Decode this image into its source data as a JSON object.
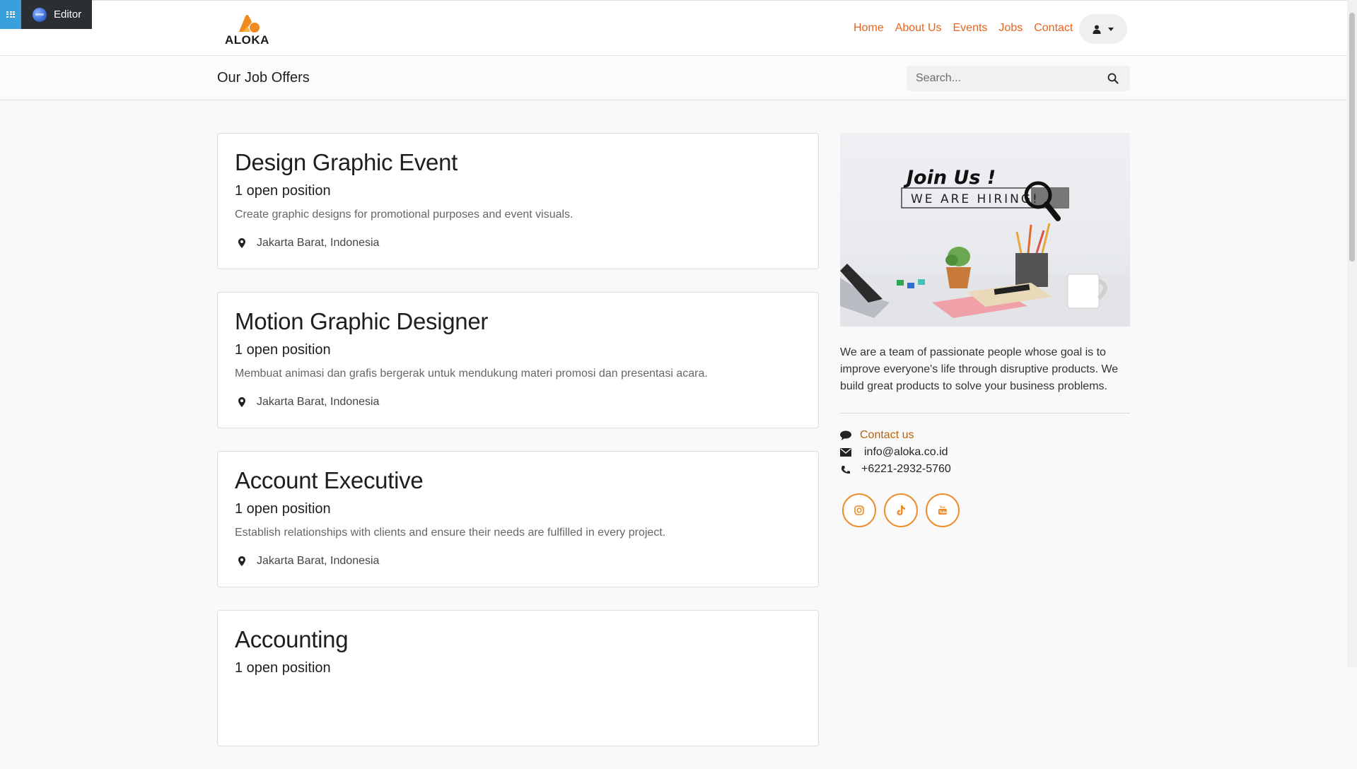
{
  "editor": {
    "label": "Editor",
    "globe_text": "www"
  },
  "header": {
    "logo_text": "ALOKA",
    "nav": [
      "Home",
      "About Us",
      "Events",
      "Jobs",
      "Contact"
    ],
    "accent_color": "#e8641c"
  },
  "subheader": {
    "title": "Our Job Offers",
    "search_placeholder": "Search..."
  },
  "jobs": [
    {
      "title": "Design Graphic Event",
      "positions": "1 open position",
      "description": "Create graphic designs for promotional purposes and event visuals.",
      "location": "Jakarta Barat, Indonesia"
    },
    {
      "title": "Motion Graphic Designer",
      "positions": "1 open position",
      "description": "Membuat animasi dan grafis bergerak untuk mendukung materi promosi dan presentasi acara.",
      "location": "Jakarta Barat, Indonesia"
    },
    {
      "title": "Account Executive",
      "positions": "1 open position",
      "description": "Establish relationships with clients and ensure their needs are fulfilled in every project.",
      "location": "Jakarta Barat, Indonesia"
    },
    {
      "title": "Accounting",
      "positions": "1 open position",
      "description": "",
      "location": ""
    }
  ],
  "sidebar": {
    "image_text": {
      "headline": "Join Us !",
      "subline": "WE ARE HIRING!"
    },
    "about": "We are a team of passionate people whose goal is to improve everyone's life through disruptive products. We build great products to solve your business problems.",
    "contact_label": "Contact us",
    "email": "info@aloka.co.id",
    "phone": "+6221-2932-5760",
    "social": [
      "instagram-icon",
      "tiktok-icon",
      "youtube-icon"
    ]
  }
}
